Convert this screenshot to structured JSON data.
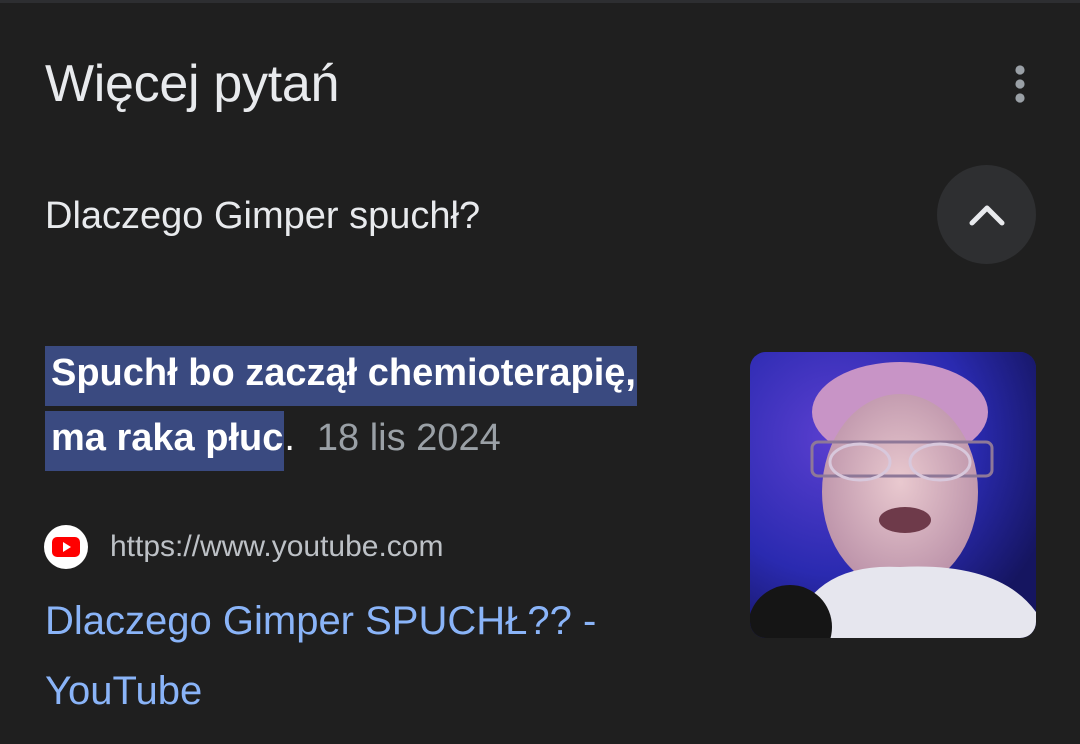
{
  "section": {
    "title": "Więcej pytań"
  },
  "question": {
    "text": "Dlaczego Gimper spuchł?"
  },
  "answer": {
    "highlight_line1": "Spuchł bo zaczął chemioterapię,",
    "highlight_line2": "ma raka płuc",
    "punctuation": ".",
    "date": "18 lis 2024"
  },
  "source": {
    "url": "https://www.youtube.com",
    "icon": "youtube-icon"
  },
  "result": {
    "title": "Dlaczego Gimper SPUCHŁ?? - YouTube"
  },
  "icons": {
    "more": "more-vert-icon",
    "collapse": "chevron-up-icon"
  },
  "colors": {
    "background": "#1f1f1f",
    "highlight": "#3a4a80",
    "link": "#8ab4f8",
    "youtube_red": "#ff0000"
  }
}
